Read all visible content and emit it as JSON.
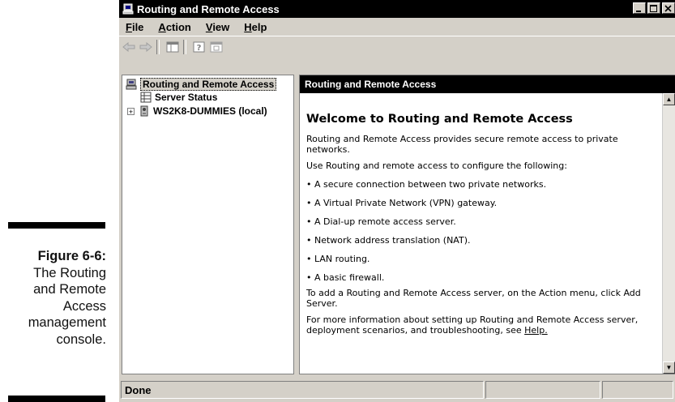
{
  "figure": {
    "number": "Figure 6-6:",
    "caption_lines": [
      "The Routing",
      "and Remote",
      "Access",
      "management",
      "console."
    ]
  },
  "window": {
    "title": "Routing and Remote Access",
    "title_icon": "server-icon",
    "controls": [
      "minimize-icon",
      "maximize-icon",
      "close-icon"
    ]
  },
  "menu": {
    "items": [
      "File",
      "Action",
      "View",
      "Help"
    ]
  },
  "toolbar": {
    "buttons": [
      "back-arrow-icon",
      "forward-arrow-icon",
      "show-hide-tree-icon",
      "help-icon",
      "console-tree-icon"
    ]
  },
  "tree": {
    "root": "Routing and Remote Access",
    "items": [
      {
        "label": "Server Status",
        "icon": "server-status-icon"
      },
      {
        "label": "WS2K8-DUMMIES (local)",
        "icon": "server-icon",
        "expander": "+"
      }
    ]
  },
  "right_pane": {
    "header": "Routing and Remote Access",
    "welcome_title": "Welcome to Routing and Remote Access",
    "intro": "Routing and Remote Access provides secure remote access to private networks.",
    "use_line": "Use Routing and remote access to configure the following:",
    "bullets": [
      "A secure connection between two private networks.",
      "A Virtual Private Network (VPN) gateway.",
      "A Dial-up remote access server.",
      "Network address translation (NAT).",
      "LAN routing.",
      "A basic firewall."
    ],
    "add_server": "To add a Routing and Remote Access server, on the Action menu, click Add Server.",
    "more_info": "For more information about setting up Routing and Remote Access server, deployment scenarios, and troubleshooting, see",
    "help_link": "Help."
  },
  "statusbar": {
    "text": "Done"
  }
}
